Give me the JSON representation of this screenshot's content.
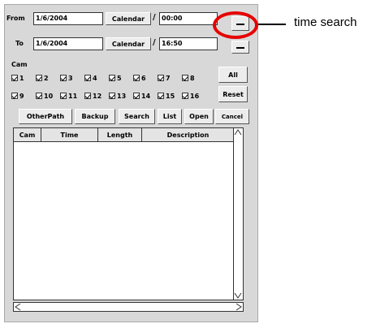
{
  "filter": {
    "from_label": "From",
    "from_date": "1/6/2004",
    "to_label": "To",
    "to_date": "1/6/2004",
    "calendar_label": "Calendar",
    "separator": "/",
    "from_time": "00:00",
    "to_time": "16:50",
    "cam_label": "Cam"
  },
  "cameras": {
    "row1": [
      "1",
      "2",
      "3",
      "4",
      "5",
      "6",
      "7",
      "8"
    ],
    "row2": [
      "9",
      "10",
      "11",
      "12",
      "13",
      "14",
      "15",
      "16"
    ],
    "all_checked": true
  },
  "buttons": {
    "all": "All",
    "reset": "Reset",
    "other_path": "OtherPath",
    "backup": "Backup",
    "search": "Search",
    "list": "List",
    "open": "Open",
    "cancel": "Cancel"
  },
  "table": {
    "columns": [
      "Cam",
      "Time",
      "Length",
      "Description"
    ],
    "rows": []
  },
  "annotation": {
    "label": "time search",
    "highlight_color": "#e60000"
  },
  "icons": {
    "time_search": "ellipsis-button-icon",
    "scroll_up": "arrow-up-icon",
    "scroll_down": "arrow-down-icon",
    "scroll_left": "arrow-left-icon",
    "scroll_right": "arrow-right-icon"
  }
}
